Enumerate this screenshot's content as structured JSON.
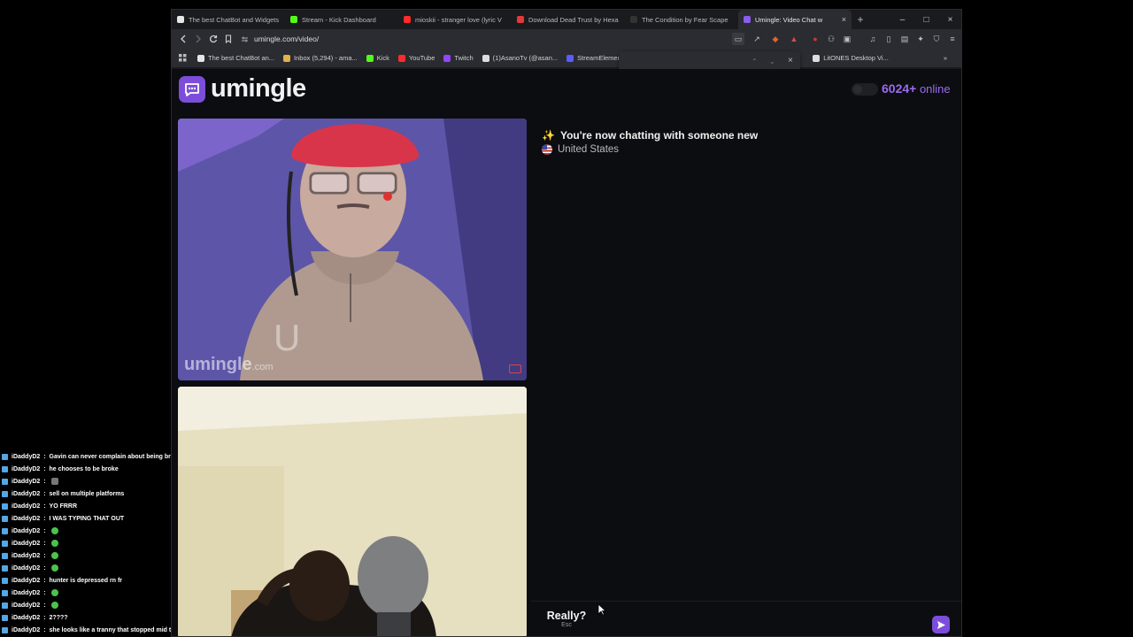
{
  "browser": {
    "tabs": [
      {
        "title": "The best ChatBot and Widgets",
        "color": "#e6e6e6",
        "active": false
      },
      {
        "title": "Stream - Kick Dashboard",
        "color": "#53fc18",
        "active": false
      },
      {
        "title": "mioskii - stranger love (lyric V",
        "color": "#ff2a2a",
        "active": false
      },
      {
        "title": "Download Dead Trust by Hexa",
        "color": "#e03a3a",
        "active": false
      },
      {
        "title": "The Condition by Fear Scape",
        "color": "#333333",
        "active": false
      },
      {
        "title": "Umingle: Video Chat w",
        "color": "#8a5cf0",
        "active": true
      }
    ],
    "new_tab": "+",
    "close_tab": "×",
    "window_minimize": "–",
    "window_maximize": "□",
    "window_close": "×",
    "url": "umingle.com/video/",
    "bookmarks": [
      {
        "label": "The best ChatBot an...",
        "color": "#e6e6e6"
      },
      {
        "label": "Inbox (5,294) - ama...",
        "color": "#e0b24a"
      },
      {
        "label": "Kick",
        "color": "#53fc18"
      },
      {
        "label": "YouTube",
        "color": "#ff2a2a"
      },
      {
        "label": "Twitch",
        "color": "#9146ff"
      },
      {
        "label": "(1)AsanoTv (@asan...",
        "color": "#dddddd"
      },
      {
        "label": "StreamElements -",
        "color": "#5b5bff"
      },
      {
        "label": "LitONES Desktop Vi...",
        "color": "#dddddd"
      }
    ],
    "bookmarks_more": "»"
  },
  "page": {
    "logo": "umingle",
    "online_count": "6024+",
    "online_label": " online",
    "watermark": "umingle",
    "watermark_suffix": ".com",
    "system_message": "You're now chatting with someone new",
    "sparkle": "✨",
    "country": "United States",
    "skip_label": "Really?",
    "skip_hint": "Esc",
    "message_placeholder": "",
    "accent": "#7c4ddb"
  },
  "stream_chat": [
    {
      "user": "iDaddyD2",
      "text": "Gavin can never complain about being broke ever again",
      "emote": ""
    },
    {
      "user": "iDaddyD2",
      "text": "he chooses to be broke",
      "emote": ""
    },
    {
      "user": "iDaddyD2",
      "text": "",
      "emote": "gray"
    },
    {
      "user": "iDaddyD2",
      "text": "sell on multiple platforms",
      "emote": ""
    },
    {
      "user": "iDaddyD2",
      "text": "YO FRRR",
      "emote": ""
    },
    {
      "user": "iDaddyD2",
      "text": "I WAS TYPING THAT OUT",
      "emote": ""
    },
    {
      "user": "iDaddyD2",
      "text": "",
      "emote": "green"
    },
    {
      "user": "iDaddyD2",
      "text": "",
      "emote": "green"
    },
    {
      "user": "iDaddyD2",
      "text": "",
      "emote": "green"
    },
    {
      "user": "iDaddyD2",
      "text": "",
      "emote": "green"
    },
    {
      "user": "iDaddyD2",
      "text": "hunter is depressed rn fr",
      "emote": ""
    },
    {
      "user": "iDaddyD2",
      "text": "",
      "emote": "green"
    },
    {
      "user": "iDaddyD2",
      "text": "",
      "emote": "green"
    },
    {
      "user": "iDaddyD2",
      "text": "2????",
      "emote": ""
    },
    {
      "user": "iDaddyD2",
      "text": "she looks like a tranny that stopped mid transition",
      "emote": ""
    }
  ]
}
